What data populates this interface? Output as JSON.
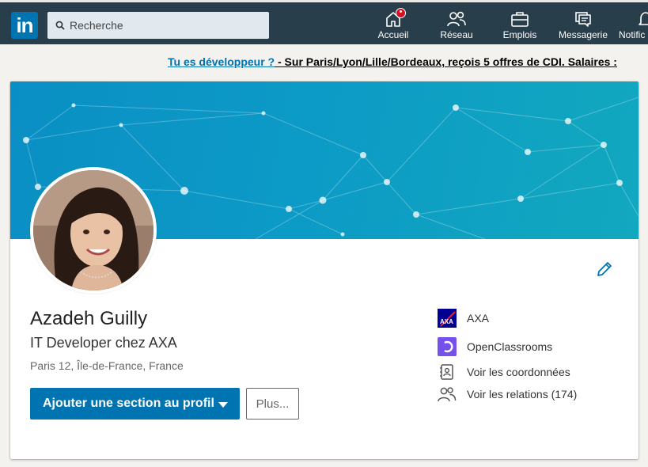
{
  "nav": {
    "logo_text": "in",
    "search_placeholder": "Recherche",
    "items": [
      {
        "label": "Accueil",
        "icon": "home-icon"
      },
      {
        "label": "Réseau",
        "icon": "network-icon"
      },
      {
        "label": "Emplois",
        "icon": "briefcase-icon"
      },
      {
        "label": "Messagerie",
        "icon": "messaging-icon"
      },
      {
        "label": "Notific",
        "icon": "bell-icon"
      }
    ]
  },
  "ad": {
    "question": "Tu es développeur ?",
    "rest": " - Sur Paris/Lyon/Lille/Bordeaux, reçois 5 offres de CDI. Salaires :"
  },
  "profile": {
    "name": "Azadeh Guilly",
    "headline": "IT Developer chez AXA",
    "location": "Paris 12, Île-de-France, France",
    "add_section_label": "Ajouter une section au profil",
    "more_label": "Plus..."
  },
  "side": {
    "company": "AXA",
    "school": "OpenClassrooms",
    "contact": "Voir les coordonnées",
    "connections": "Voir les relations (174)"
  },
  "colors": {
    "brand": "#0073b1",
    "nav_bg": "#283e4a",
    "banner": "#0c9ac6"
  }
}
